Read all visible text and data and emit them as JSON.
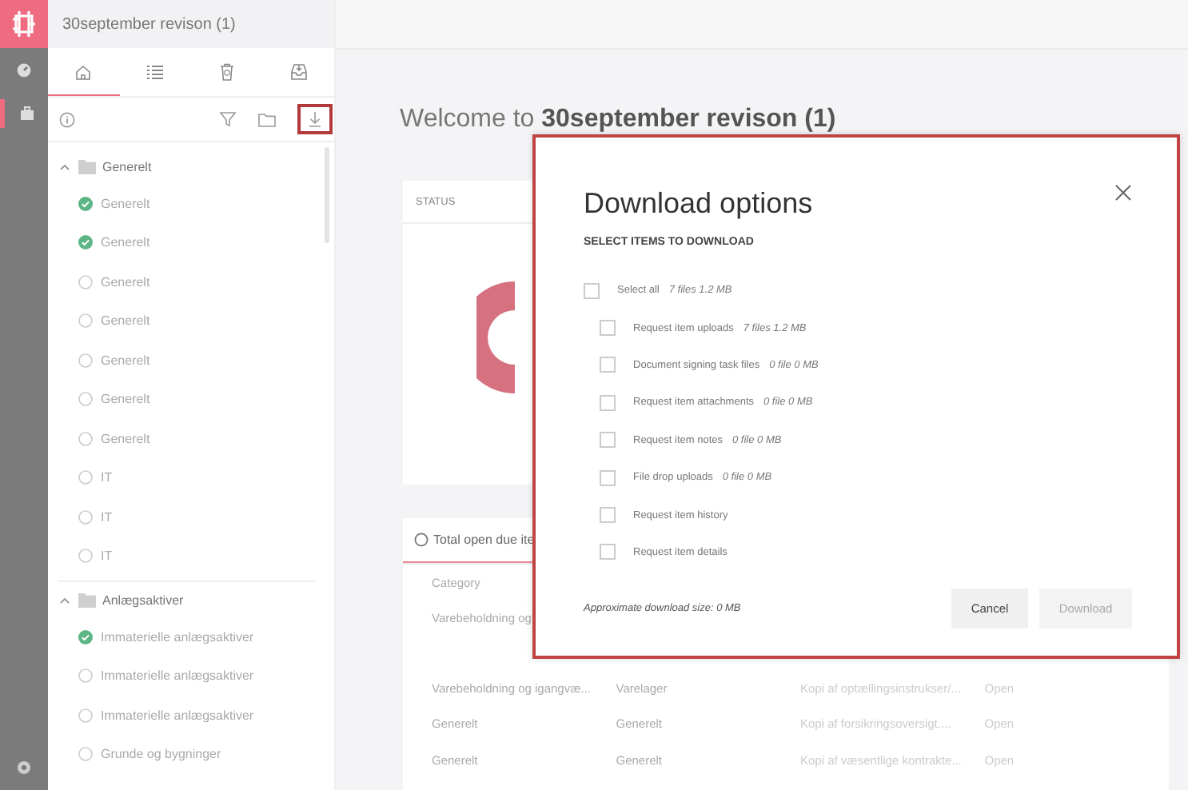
{
  "project": {
    "title": "30september revison (1)"
  },
  "sidebar_tabs": [
    {
      "kind": "home",
      "selected": true
    },
    {
      "kind": "list",
      "selected": false
    },
    {
      "kind": "trash",
      "selected": false
    },
    {
      "kind": "inbox",
      "selected": false
    }
  ],
  "tree": [
    {
      "label": "Generelt",
      "expanded": true,
      "children": [
        {
          "label": "Generelt",
          "done": true
        },
        {
          "label": "Generelt",
          "done": true
        },
        {
          "label": "Generelt",
          "done": false
        },
        {
          "label": "Generelt",
          "done": false
        },
        {
          "label": "Generelt",
          "done": false
        },
        {
          "label": "Generelt",
          "done": false
        },
        {
          "label": "Generelt",
          "done": false
        },
        {
          "label": "IT",
          "done": false
        },
        {
          "label": "IT",
          "done": false
        },
        {
          "label": "IT",
          "done": false
        }
      ]
    },
    {
      "label": "Anlægsaktiver",
      "expanded": true,
      "children": [
        {
          "label": "Immaterielle anlægsaktiver",
          "done": true
        },
        {
          "label": "Immaterielle anlægsaktiver",
          "done": false
        },
        {
          "label": "Immaterielle anlægsaktiver",
          "done": false
        },
        {
          "label": "Grunde og bygninger",
          "done": false
        }
      ]
    }
  ],
  "welcome": "Welcome to **30september revison (1)**",
  "status_card": {
    "title": "STATUS"
  },
  "due_card": {
    "tab": "Total open due ite",
    "columns": [
      "Category"
    ],
    "rows": [
      [
        "Varebeholdning og"
      ],
      [
        "Varebeholdning og igangvæ...",
        "Varelager",
        "Kopi af optællingsinstrukser/...",
        "Open"
      ],
      [
        "Generelt",
        "Generelt",
        "Kopi af forsikringsoversigt....",
        "Open"
      ],
      [
        "Generelt",
        "Generelt",
        "Kopi af væsentlige kontrakte...",
        "Open"
      ]
    ]
  },
  "dialog": {
    "title": "Download options",
    "subtitle": "SELECT ITEMS TO DOWNLOAD",
    "select_all": {
      "label": "Select all",
      "info": "7 files 1.2 MB",
      "checked": false
    },
    "options": [
      {
        "label": "Request item uploads",
        "info": "7 files 1.2 MB",
        "checked": false
      },
      {
        "label": "Document signing task files",
        "info": "0 file 0 MB",
        "checked": false
      },
      {
        "label": "Request item attachments",
        "info": "0 file 0 MB",
        "checked": false
      },
      {
        "label": "Request item notes",
        "info": "0 file 0 MB",
        "checked": false
      },
      {
        "label": "File drop uploads",
        "info": "0 file 0 MB",
        "checked": false
      },
      {
        "label": "Request item history",
        "checked": false
      },
      {
        "label": "Request item details",
        "checked": false
      }
    ],
    "size": "Approximate download size: 0 MB",
    "buttons": [
      {
        "label": "Cancel",
        "disabled": false
      },
      {
        "label": "Download",
        "disabled": true
      }
    ]
  }
}
